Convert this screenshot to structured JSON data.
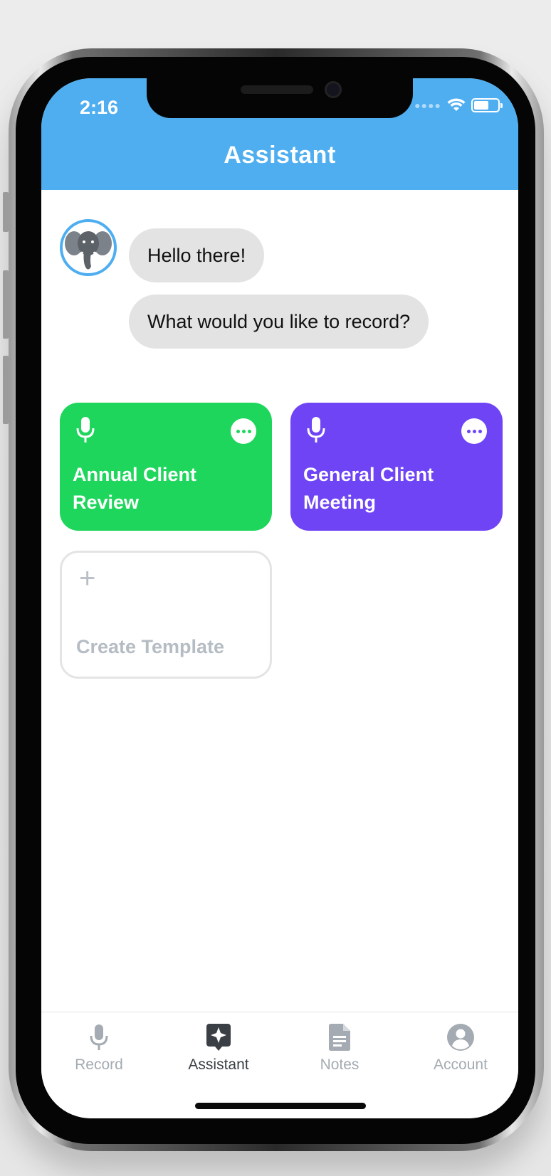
{
  "status_bar": {
    "time": "2:16"
  },
  "header": {
    "title": "Assistant"
  },
  "chat": {
    "messages": [
      "Hello there!",
      "What would you like to record?"
    ]
  },
  "templates": [
    {
      "label_line1": "Annual Client",
      "label_line2": "Review",
      "color": "#1ed65c",
      "icon": "microphone-icon"
    },
    {
      "label_line1": "General Client",
      "label_line2": "Meeting",
      "color": "#6e44f5",
      "icon": "microphone-icon"
    }
  ],
  "create_template": {
    "label": "Create Template",
    "icon": "plus-icon"
  },
  "tabbar": {
    "tabs": [
      {
        "label": "Record",
        "icon": "microphone-icon",
        "active": false
      },
      {
        "label": "Assistant",
        "icon": "sparkle-icon",
        "active": true
      },
      {
        "label": "Notes",
        "icon": "document-icon",
        "active": false
      },
      {
        "label": "Account",
        "icon": "user-icon",
        "active": false
      }
    ]
  },
  "colors": {
    "header": "#4eaef0",
    "bubble": "#e3e3e3",
    "tab_active": "#3a3f45",
    "tab_inactive": "#a4abb2"
  }
}
